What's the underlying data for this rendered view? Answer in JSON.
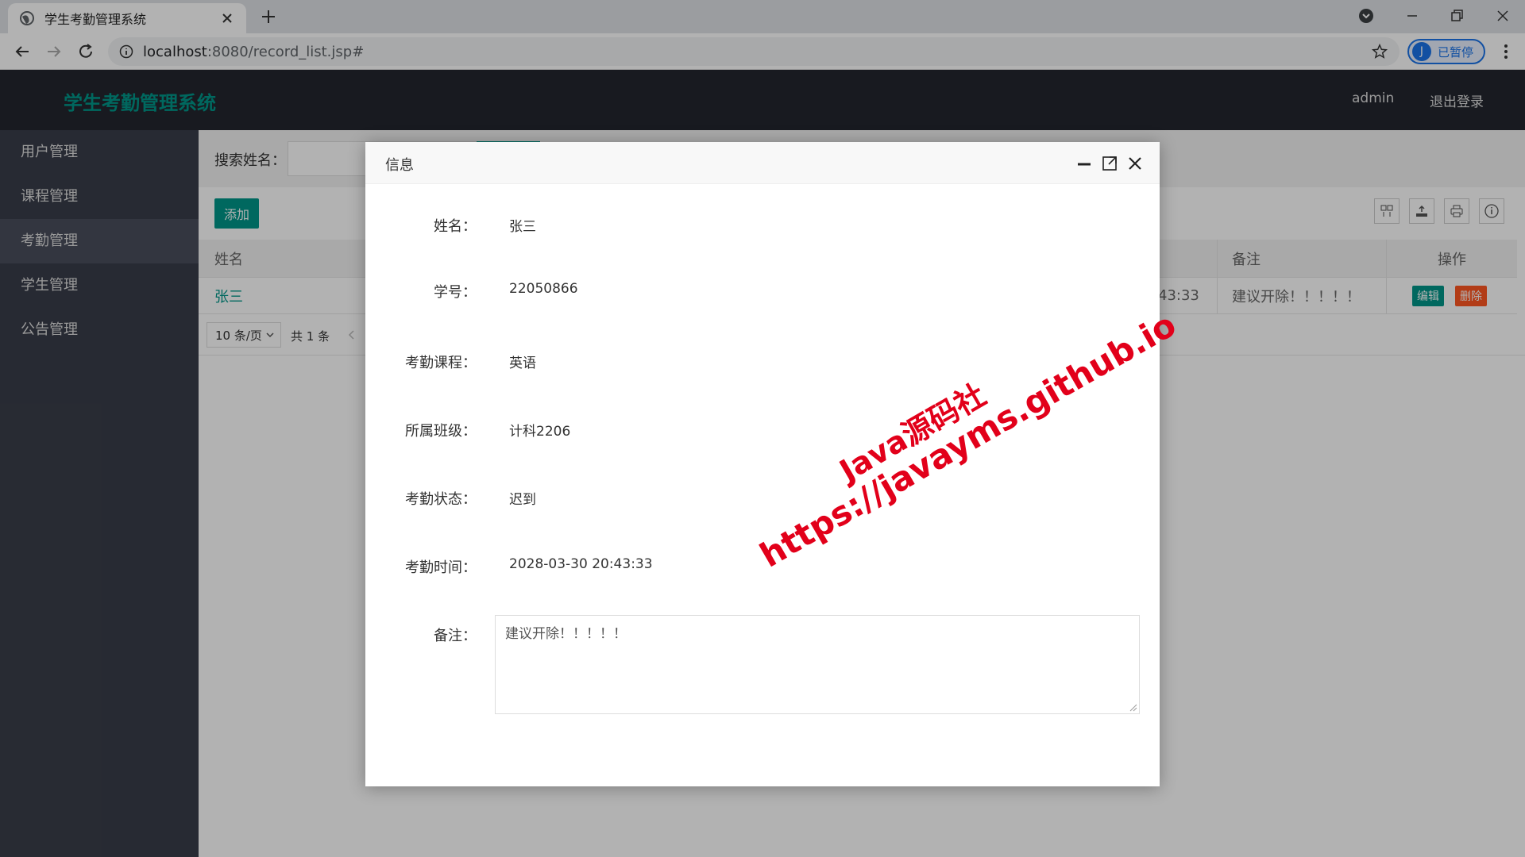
{
  "browser": {
    "tab_title": "学生考勤管理系统",
    "url_host": "localhost",
    "url_rest": ":8080/record_list.jsp#",
    "profile_initial": "J",
    "profile_label": "已暂停"
  },
  "header": {
    "logo": "学生考勤管理系统",
    "user": "admin",
    "logout": "退出登录"
  },
  "sidebar": {
    "items": [
      {
        "label": "用户管理"
      },
      {
        "label": "课程管理"
      },
      {
        "label": "考勤管理",
        "active": true
      },
      {
        "label": "学生管理"
      },
      {
        "label": "公告管理"
      }
    ]
  },
  "main": {
    "search_label": "搜索姓名：",
    "add_label": "添加",
    "columns": {
      "name": "姓名",
      "remark": "备注",
      "action": "操作"
    },
    "row": {
      "name": "张三",
      "time_partial": "43:33",
      "remark": "建议开除！！！！！",
      "edit": "编辑",
      "delete": "删除"
    },
    "pager": {
      "page_size": "10 条/页",
      "total": "共 1 条"
    }
  },
  "modal": {
    "title": "信息",
    "fields": {
      "name_label": "姓名：",
      "name_value": "张三",
      "sid_label": "学号：",
      "sid_value": "22050866",
      "course_label": "考勤课程：",
      "course_value": "英语",
      "class_label": "所属班级：",
      "class_value": "计科2206",
      "status_label": "考勤状态：",
      "status_value": "迟到",
      "time_label": "考勤时间：",
      "time_value": "2028-03-30 20:43:33",
      "remark_label": "备注：",
      "remark_value": "建议开除！！！！！"
    }
  },
  "watermark": {
    "line1": "Java源码社",
    "line2": "https://javayms.github.io"
  },
  "colors": {
    "brand": "#009688",
    "danger": "#ff5722",
    "header_bg": "#23262e",
    "sidebar_bg": "#393d49",
    "watermark": "#e2001a"
  }
}
